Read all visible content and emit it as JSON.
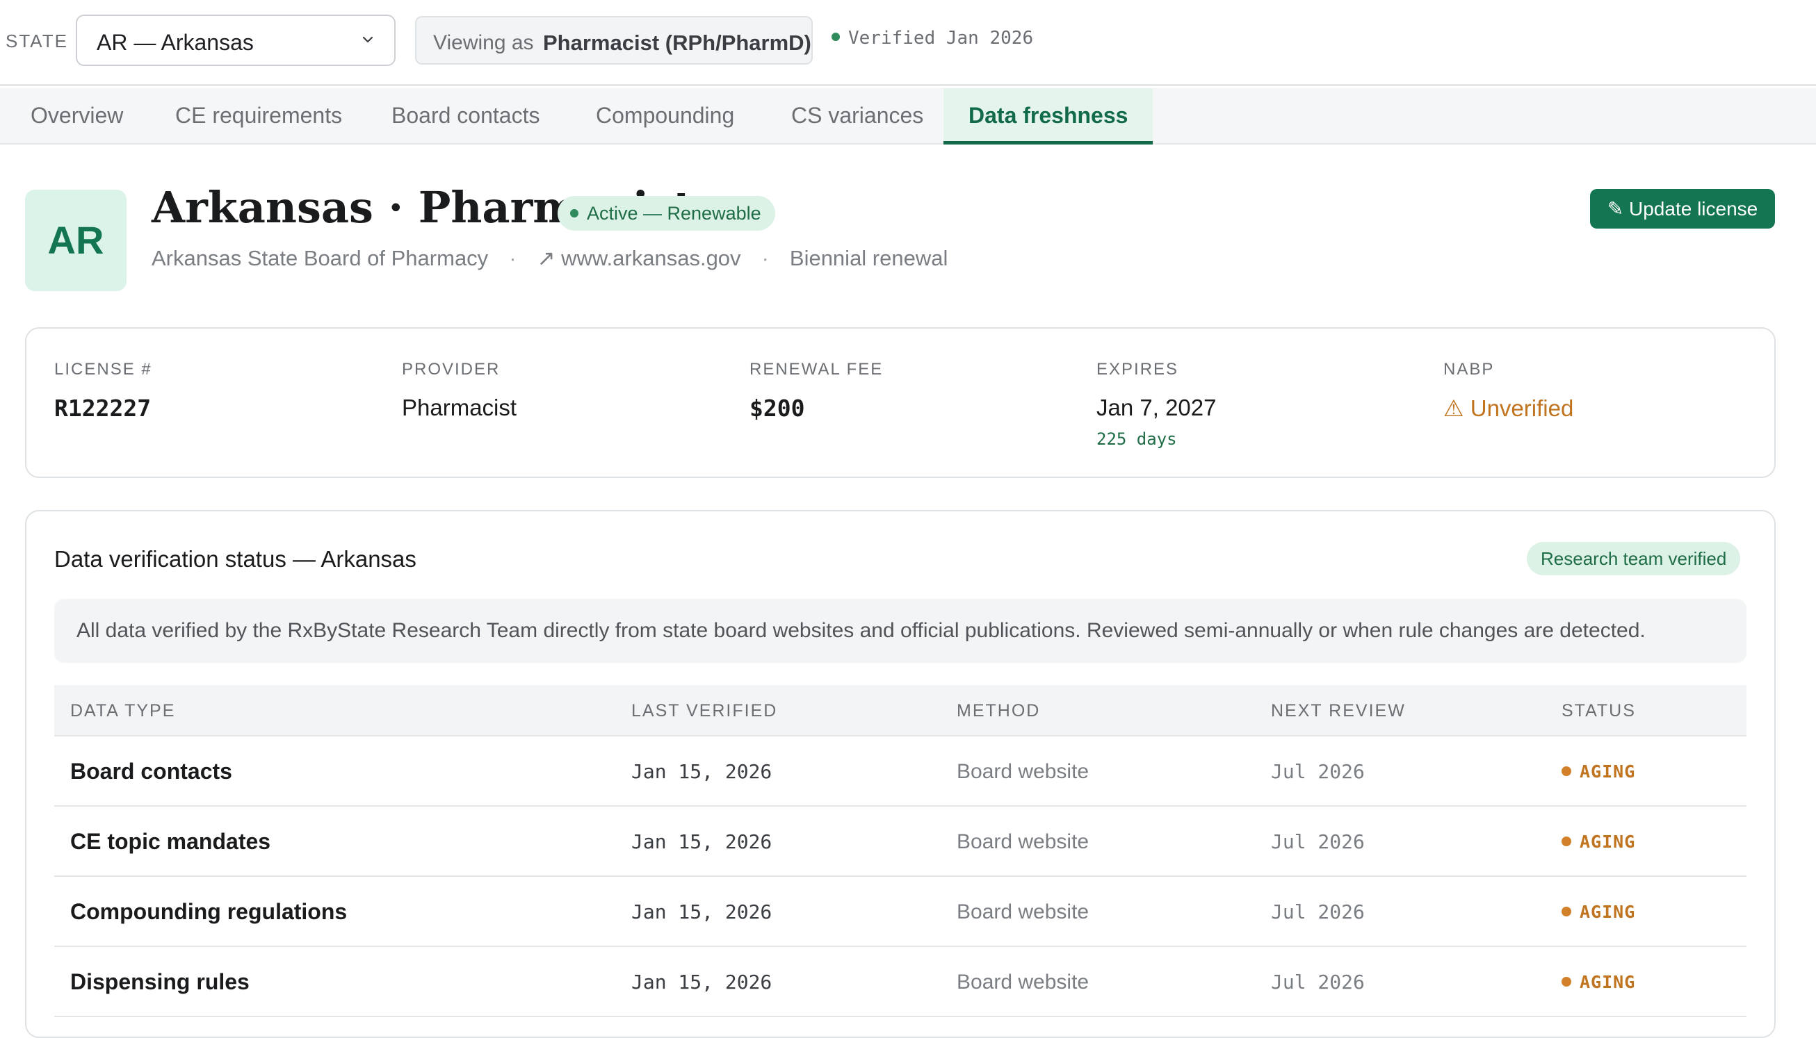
{
  "topbar": {
    "state_label": "STATE",
    "state_value": "AR — Arkansas",
    "viewing_label": "Viewing as",
    "viewing_role": "Pharmacist (RPh/PharmD)",
    "verified_text": "Verified Jan 2026"
  },
  "tabs": [
    {
      "label": "Overview"
    },
    {
      "label": "CE requirements"
    },
    {
      "label": "Board contacts"
    },
    {
      "label": "Compounding"
    },
    {
      "label": "CS variances"
    },
    {
      "label": "Data freshness",
      "active": true
    }
  ],
  "header": {
    "avatar": "AR",
    "title": "Arkansas · Pharmacist",
    "status": "Active — Renewable",
    "board": "Arkansas State Board of Pharmacy",
    "sep": "·",
    "website": "↗ www.arkansas.gov",
    "renewal": "Biennial renewal",
    "update_button": "✎ Update license"
  },
  "license": {
    "number_label": "LICENSE #",
    "number": "R122227",
    "provider_label": "PROVIDER",
    "provider": "Pharmacist",
    "fee_label": "RENEWAL FEE",
    "fee": "$200",
    "expires_label": "EXPIRES",
    "expires": "Jan 7, 2027",
    "expires_days": "225 days",
    "nabp_label": "NABP",
    "nabp": "⚠ Unverified"
  },
  "verification": {
    "title": "Data verification status — Arkansas",
    "badge": "Research team verified",
    "note": "All data verified by the RxByState Research Team directly from state board websites and official publications. Reviewed semi-annually or when rule changes are detected.",
    "columns": [
      "DATA TYPE",
      "LAST VERIFIED",
      "METHOD",
      "NEXT REVIEW",
      "STATUS"
    ],
    "rows": [
      {
        "type": "Board contacts",
        "last": "Jan 15, 2026",
        "method": "Board website",
        "next": "Jul 2026",
        "status": "AGING"
      },
      {
        "type": "CE topic mandates",
        "last": "Jan 15, 2026",
        "method": "Board website",
        "next": "Jul 2026",
        "status": "AGING"
      },
      {
        "type": "Compounding regulations",
        "last": "Jan 15, 2026",
        "method": "Board website",
        "next": "Jul 2026",
        "status": "AGING"
      },
      {
        "type": "Dispensing rules",
        "last": "Jan 15, 2026",
        "method": "Board website",
        "next": "Jul 2026",
        "status": "AGING"
      }
    ]
  },
  "colors": {
    "brand": "#137551",
    "status_active_bg": "#dcf2e6",
    "aging": "#c0741f",
    "warning": "#c0741f"
  }
}
